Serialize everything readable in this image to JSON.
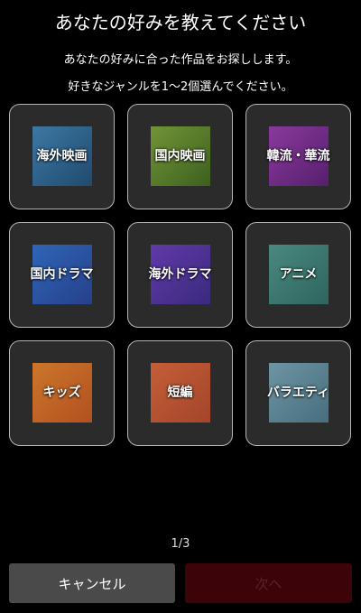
{
  "header": {
    "title": "あなたの好みを教えてください",
    "description": "あなたの好みに合った作品をお探しします。",
    "instruction": "好きなジャンルを1〜2個選んでください。"
  },
  "genres": [
    {
      "label": "海外映画",
      "thumb_colors": [
        "#3f86b8",
        "#1e4f7a"
      ]
    },
    {
      "label": "国内映画",
      "thumb_colors": [
        "#7ea63a",
        "#3f6a1c"
      ]
    },
    {
      "label": "韓流・華流",
      "thumb_colors": [
        "#9b3bb0",
        "#5c1e78"
      ]
    },
    {
      "label": "国内ドラマ",
      "thumb_colors": [
        "#2f6fd0",
        "#26449a"
      ]
    },
    {
      "label": "海外ドラマ",
      "thumb_colors": [
        "#6a3cc0",
        "#3d2a8a"
      ]
    },
    {
      "label": "アニメ",
      "thumb_colors": [
        "#4f9a8e",
        "#2f6f68"
      ]
    },
    {
      "label": "キッズ",
      "thumb_colors": [
        "#e8842a",
        "#c9571e"
      ]
    },
    {
      "label": "短編",
      "thumb_colors": [
        "#e0673a",
        "#b84a2a"
      ]
    },
    {
      "label": "バラエティ",
      "thumb_colors": [
        "#7aa7b8",
        "#4b7a8c"
      ]
    }
  ],
  "pagination": {
    "indicator": "1/3"
  },
  "footer": {
    "cancel_label": "キャンセル",
    "next_label": "次へ"
  }
}
